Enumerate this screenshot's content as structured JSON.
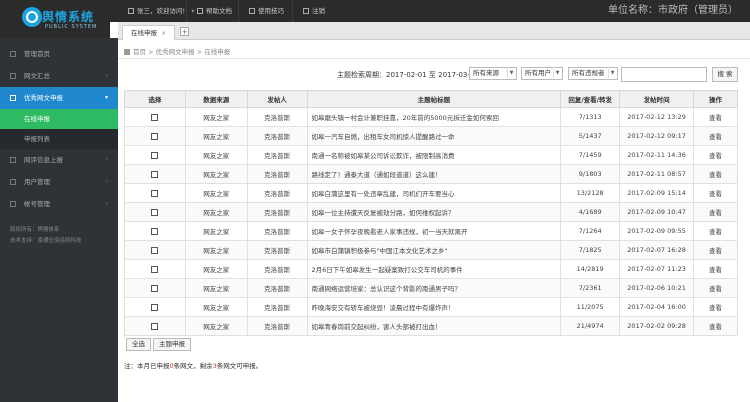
{
  "app": {
    "logo_title": "舆情系统",
    "logo_subtitle": "PUBLIC SYSTEM"
  },
  "topbar": {
    "welcome": "张三，欢迎访问!",
    "help": "帮助文档",
    "common": "使用技巧",
    "logout": "注销",
    "org": "单位名称：市政府（管理员）"
  },
  "sidebar": {
    "items": [
      {
        "label": "管理首页"
      },
      {
        "label": "网文汇总"
      },
      {
        "label": "优秀网文申报"
      },
      {
        "label": "网评信息上报"
      },
      {
        "label": "用户管理"
      },
      {
        "label": "帐号管理"
      }
    ],
    "sub_items": [
      {
        "label": "在线申报"
      },
      {
        "label": "申报列表"
      }
    ],
    "footer_line1": "版权所有：舆情体系",
    "footer_line2": "技术支持：南通伍佰运网科技"
  },
  "tabs": [
    {
      "label": "在线申报"
    }
  ],
  "breadcrumb": {
    "home": "首页",
    "sep1": ">",
    "level1": "优秀网文申报",
    "sep2": ">",
    "level2": "在线申报"
  },
  "filter": {
    "label": "主题检索周期：2017-02-01 至 2017-03-01",
    "source_select": "所有来源",
    "user_select": "所有用户",
    "level_select": "所有违规者",
    "search_placeholder": "",
    "search_button": "搜 索"
  },
  "table": {
    "headers": [
      "选择",
      "数据来源",
      "发帖人",
      "主题帖标题",
      "回复/查看/转发",
      "发帖时间",
      "操作"
    ],
    "rows": [
      {
        "source": "网友之家",
        "poster": "克洛普斯",
        "title": "如皋磨头镇一村会计兼职挂靠，20年前的5000元拆迁金如何索回",
        "stats": "7/1313",
        "time": "2017-02-12 13:29",
        "action": "查看"
      },
      {
        "source": "网友之家",
        "poster": "克洛普斯",
        "title": "如皋一汽车自燃，出租车女司机惊人提醒路过一命",
        "stats": "5/1437",
        "time": "2017-02-12 09:17",
        "action": "查看"
      },
      {
        "source": "网友之家",
        "poster": "克洛普斯",
        "title": "南通一名称被如皋某公司诉讼欺诈，被限制高消费",
        "stats": "7/1459",
        "time": "2017-02-11 14:36",
        "action": "查看"
      },
      {
        "source": "网友之家",
        "poster": "克洛普斯",
        "title": "路线定了！通泰大道（通如段道道）这么建！",
        "stats": "9/1803",
        "time": "2017-02-11 08:57",
        "action": "查看"
      },
      {
        "source": "网友之家",
        "poster": "克洛普斯",
        "title": "如皋白蒲这里有一处违章乱建，司机们开车要当心",
        "stats": "13/2128",
        "time": "2017-02-09 15:14",
        "action": "查看"
      },
      {
        "source": "网友之家",
        "poster": "克洛普斯",
        "title": "如皋一位主持遭天反复被劫分路，如何维权起诉？",
        "stats": "4/1689",
        "time": "2017-02-09 10:47",
        "action": "查看"
      },
      {
        "source": "网友之家",
        "poster": "克洛普斯",
        "title": "如皋一女子怀孕夜晚看老人家事违规，初一当天就离开",
        "stats": "7/1264",
        "time": "2017-02-09 09:55",
        "action": "查看"
      },
      {
        "source": "网友之家",
        "poster": "克洛普斯",
        "title": "如皋市白蒲镇积极参与\"中国江本文化艺术之乡\"",
        "stats": "7/1825",
        "time": "2017-02-07 16:28",
        "action": "查看"
      },
      {
        "source": "网友之家",
        "poster": "克洛普斯",
        "title": "2月6日下午如皋发生一起疑案致打公交车司机的事件",
        "stats": "14/2819",
        "time": "2017-02-07 11:23",
        "action": "查看"
      },
      {
        "source": "网友之家",
        "poster": "克洛普斯",
        "title": "南通网络运营培家：总认识这个背影的南通男子吗？",
        "stats": "7/2361",
        "time": "2017-02-06 10:21",
        "action": "查看"
      },
      {
        "source": "网友之家",
        "poster": "克洛普斯",
        "title": "昨晚海安交有轿车被烧毁！凌晨过程中有爆炸声！",
        "stats": "11/2075",
        "time": "2017-02-04 16:00",
        "action": "查看"
      },
      {
        "source": "网友之家",
        "poster": "克洛普斯",
        "title": "如皋青春岗前交起纠纷，害人头部被打出血！",
        "stats": "21/4974",
        "time": "2017-02-02 09:28",
        "action": "查看"
      }
    ]
  },
  "actions": {
    "select_all": "全选",
    "submit": "主题申报"
  },
  "note": {
    "prefix": "注：本月已申报",
    "count_done": "0",
    "middle": "条网文，剩余",
    "count_left": "3",
    "suffix": "条网文可申报。"
  },
  "colors": {
    "topbar": "#2b2b2b",
    "sidebar": "#2f3237",
    "active_blue": "#1f88cf",
    "current_green": "#2dba63",
    "logo_blue": "#1da3e0",
    "note_red": "#d9352b"
  }
}
